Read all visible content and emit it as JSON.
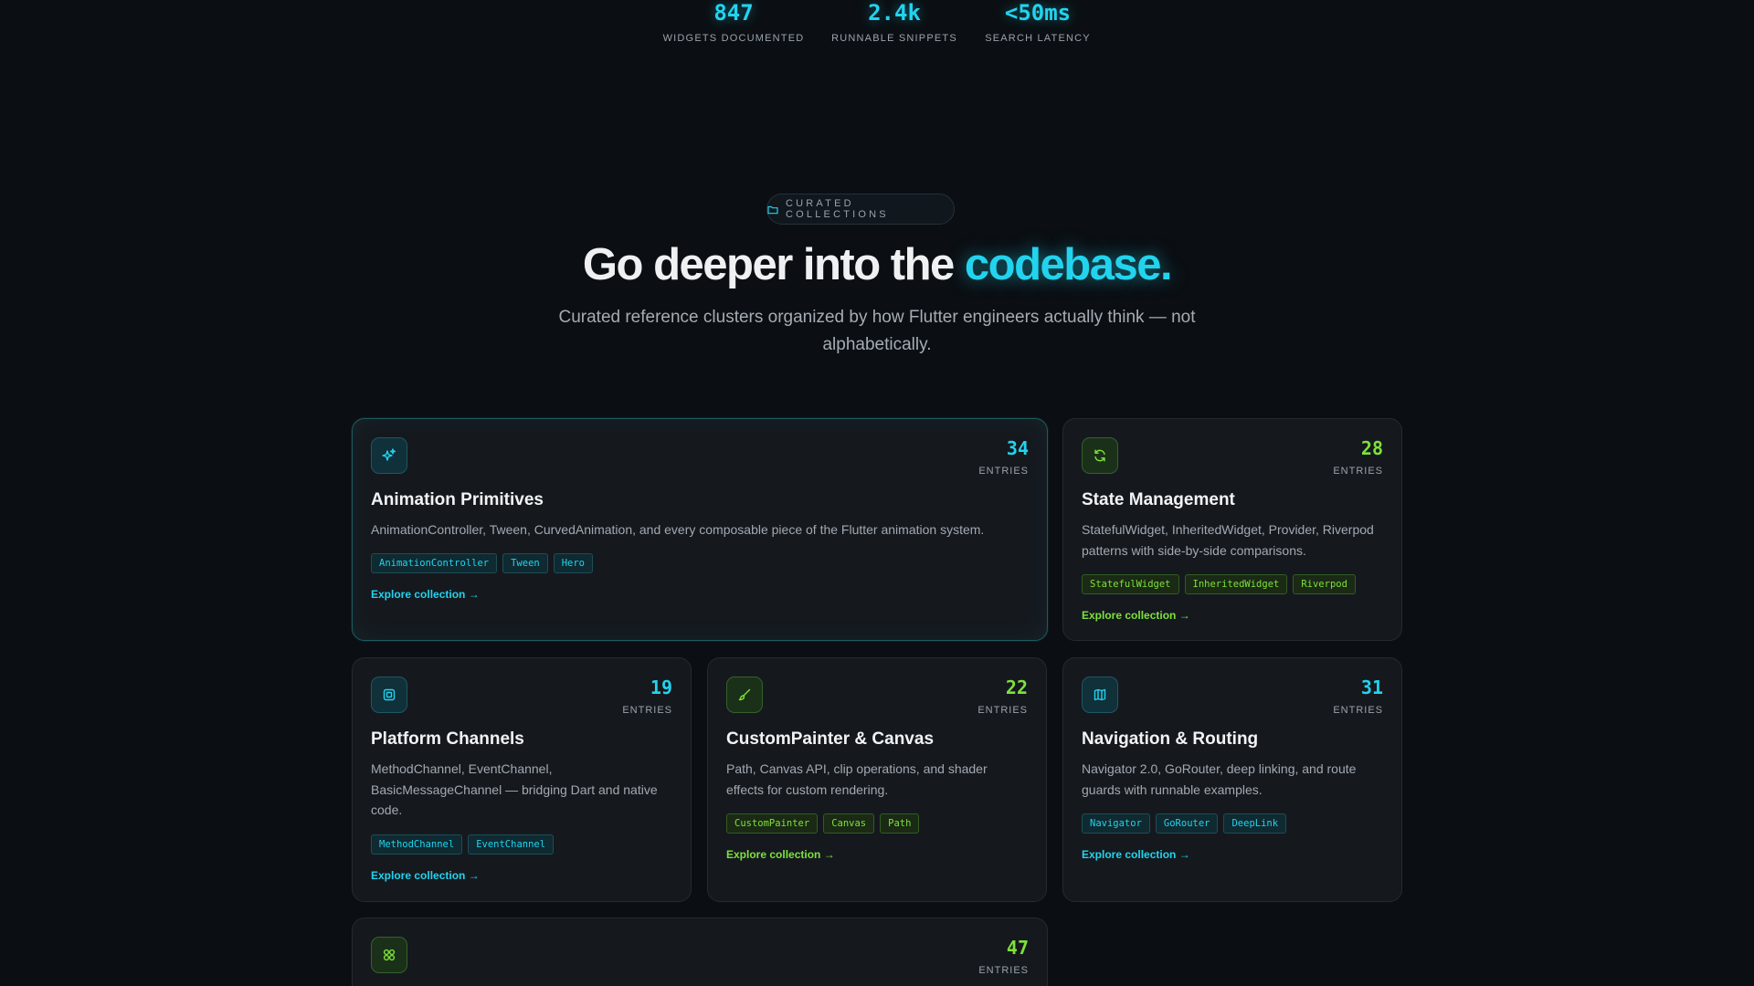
{
  "stats": [
    {
      "value": "847",
      "label": "WIDGETS DOCUMENTED"
    },
    {
      "value": "2.4k",
      "label": "RUNNABLE SNIPPETS"
    },
    {
      "value": "<50ms",
      "label": "SEARCH LATENCY"
    }
  ],
  "section": {
    "pill_label": "CURATED COLLECTIONS",
    "pill_icon": "folder-icon",
    "headline_main": "Go deeper into the ",
    "headline_accent": "codebase.",
    "subhead": "Curated reference clusters organized by how Flutter engineers actually think — not alphabetically."
  },
  "colors": {
    "accent_cyan": "#22d3ee",
    "accent_green": "#7ee13b",
    "background": "#0b0f13",
    "card": "#15191e"
  },
  "cards": [
    {
      "icon": "sparkles-icon",
      "count": "34",
      "count_label": "ENTRIES",
      "title": "Animation Primitives",
      "description": "AnimationController, Tween, CurvedAnimation, and every composable piece of the Flutter animation system.",
      "tags": [
        "AnimationController",
        "Tween",
        "Hero"
      ],
      "link": "Explore collection →"
    },
    {
      "icon": "refresh-icon",
      "count": "28",
      "count_label": "ENTRIES",
      "title": "State Management",
      "description": "StatefulWidget, InheritedWidget, Provider, Riverpod patterns with side-by-side comparisons.",
      "tags": [
        "StatefulWidget",
        "InheritedWidget",
        "Riverpod"
      ],
      "link": "Explore collection →"
    },
    {
      "icon": "chip-icon",
      "count": "19",
      "count_label": "ENTRIES",
      "title": "Platform Channels",
      "description": "MethodChannel, EventChannel, BasicMessageChannel — bridging Dart and native code.",
      "tags": [
        "MethodChannel",
        "EventChannel"
      ],
      "link": "Explore collection →"
    },
    {
      "icon": "brush-icon",
      "count": "22",
      "count_label": "ENTRIES",
      "title": "CustomPainter & Canvas",
      "description": "Path, Canvas API, clip operations, and shader effects for custom rendering.",
      "tags": [
        "CustomPainter",
        "Canvas",
        "Path"
      ],
      "link": "Explore collection →"
    },
    {
      "icon": "map-icon",
      "count": "31",
      "count_label": "ENTRIES",
      "title": "Navigation & Routing",
      "description": "Navigator 2.0, GoRouter, deep linking, and route guards with runnable examples.",
      "tags": [
        "Navigator",
        "GoRouter",
        "DeepLink"
      ],
      "link": "Explore collection →"
    },
    {
      "icon": "grid-icon",
      "count": "47",
      "count_label": "ENTRIES"
    }
  ]
}
